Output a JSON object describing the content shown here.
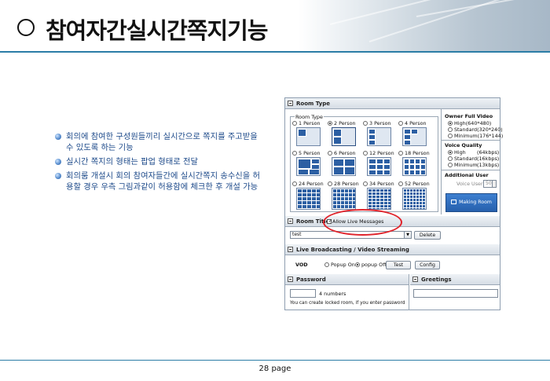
{
  "header": {
    "title": "참여자간실시간쪽지기능"
  },
  "bullets": [
    "회의에 참여한 구성원들끼리 실시간으로 쪽지를 주고받을 수 있도록 하는 기능",
    "실시간 쪽지의 형태는 팝업 형태로 전달",
    "회의룸 개설시 회의 참여자들간에 실시간쪽지 송수신을 허용할 경우 우측 그림과같이 허용함에 체크한 후 개설 가능"
  ],
  "room_type": {
    "section_label": "Room Type",
    "group_label": "Room Type",
    "options": [
      {
        "label": "1 Person",
        "selected": false
      },
      {
        "label": "2 Person",
        "selected": true
      },
      {
        "label": "3 Person",
        "selected": false
      },
      {
        "label": "4 Person",
        "selected": false
      },
      {
        "label": "5 Person",
        "selected": false
      },
      {
        "label": "6 Person",
        "selected": false
      },
      {
        "label": "12 Person",
        "selected": false
      },
      {
        "label": "18 Person",
        "selected": false
      },
      {
        "label": "24 Person",
        "selected": false
      },
      {
        "label": "28 Person",
        "selected": false
      },
      {
        "label": "34 Person",
        "selected": false
      },
      {
        "label": "52 Person",
        "selected": false
      }
    ]
  },
  "owner_video": {
    "label": "Owner Full Video",
    "options": [
      {
        "label": "High(640*480)",
        "selected": true
      },
      {
        "label": "Standard(320*240)",
        "selected": false
      },
      {
        "label": "Minimum(176*144)",
        "selected": false
      }
    ]
  },
  "voice_quality": {
    "label": "Voice Quality",
    "options": [
      {
        "label": "High",
        "rate": "(64kbps)",
        "selected": true
      },
      {
        "label": "Standard",
        "rate": "(16kbps)",
        "selected": false
      },
      {
        "label": "Minimum",
        "rate": "(13kbps)",
        "selected": false
      }
    ]
  },
  "additional_user": {
    "label": "Additional User",
    "voice_user_label": "Voice User",
    "voice_user_value": "50"
  },
  "making_room_label": "Making Room",
  "room_title": {
    "section_label": "Room Title",
    "allow_live_messages_label": "Allow Live Messages",
    "allow_live_messages_checked": true,
    "value": "test",
    "delete_label": "Delete"
  },
  "live": {
    "section_label": "Live Broadcasting / Video Streaming",
    "vod_label": "VOD",
    "popup_on_label": "Popup On",
    "popup_off_label": "popup Off",
    "popup_off_selected": true,
    "test_label": "Test",
    "config_label": "Config"
  },
  "password": {
    "section_label": "Password",
    "value": "",
    "hint": "4 numbers",
    "note": "You can create locked room, if you enter password"
  },
  "greetings": {
    "section_label": "Greetings",
    "value": ""
  },
  "footer": {
    "page": "28 page"
  },
  "colors": {
    "accent_line": "#2b7da6",
    "bullet_text": "#1d4a8a",
    "highlight": "#e0232b",
    "button_blue": "#2760ad"
  }
}
